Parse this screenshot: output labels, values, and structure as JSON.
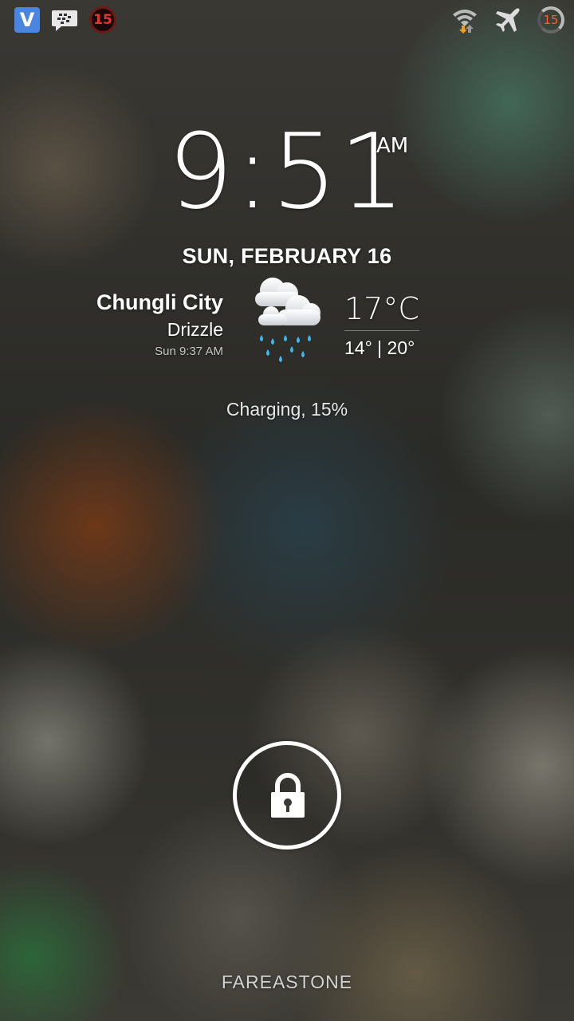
{
  "status_bar": {
    "left_icons": [
      "vcast-app-icon",
      "bbm-icon",
      "notification-count-icon"
    ],
    "notification_count": "15",
    "right_icons": [
      "wifi-icon",
      "airplane-mode-icon",
      "battery-icon"
    ],
    "battery_level": "15"
  },
  "clock": {
    "time": "9:51",
    "ampm": "AM",
    "date": "SUN, FEBRUARY 16"
  },
  "weather": {
    "city": "Chungli City",
    "condition": "Drizzle",
    "updated": "Sun 9:37 AM",
    "temperature": "17°C",
    "low_high": "14° | 20°",
    "icon": "rain-cloud-icon"
  },
  "charging_status": "Charging, 15%",
  "lock": {
    "icon": "lock-icon"
  },
  "carrier": "FAREASTONE",
  "colors": {
    "app_v": "#4a86e0",
    "badge_red": "#e03a30",
    "battery_text": "#ff5a30"
  }
}
